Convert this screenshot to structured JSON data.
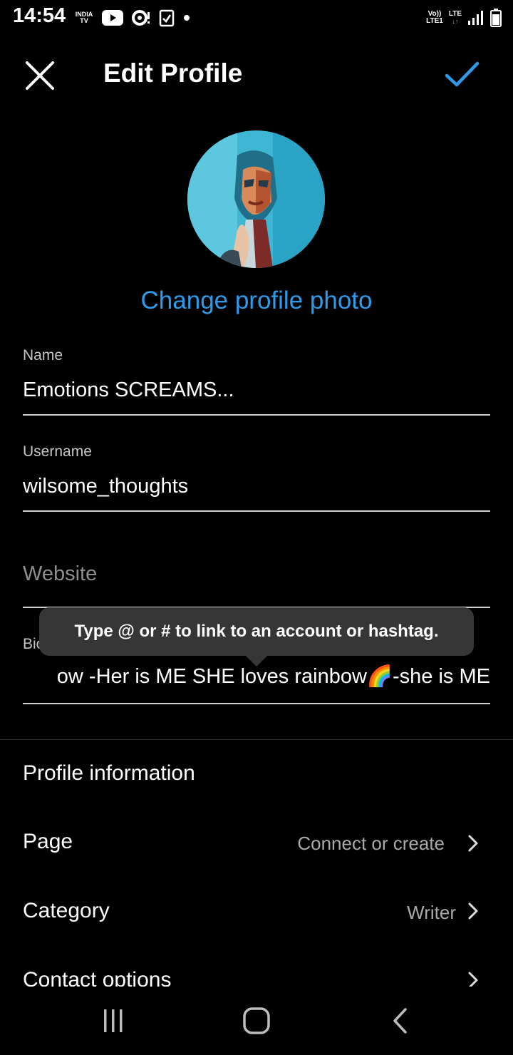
{
  "status_bar": {
    "time": "14:54",
    "india_tv_line1": "INDIA",
    "india_tv_line2": "TV",
    "volte_line1": "Vo))",
    "volte_line2": "LTE1",
    "lte": "LTE"
  },
  "header": {
    "title": "Edit Profile"
  },
  "profile": {
    "change_photo_label": "Change profile photo"
  },
  "fields": {
    "name_label": "Name",
    "name_value": "Emotions SCREAMS...",
    "username_label": "Username",
    "username_value": "wilsome_thoughts",
    "website_placeholder": "Website",
    "bio_label": "Bio",
    "bio_value": "ow -Her is ME SHE loves rainbow🌈-she is ME"
  },
  "tooltip": {
    "text": "Type @ or # to link to an account or hashtag."
  },
  "profile_information": {
    "title": "Profile information",
    "rows": [
      {
        "label": "Page",
        "value": "Connect or create"
      },
      {
        "label": "Category",
        "value": "Writer"
      },
      {
        "label": "Contact options",
        "value": ""
      }
    ]
  },
  "colors": {
    "accent": "#2f9ae8",
    "background": "#000000",
    "tooltip_bg": "#363636"
  }
}
